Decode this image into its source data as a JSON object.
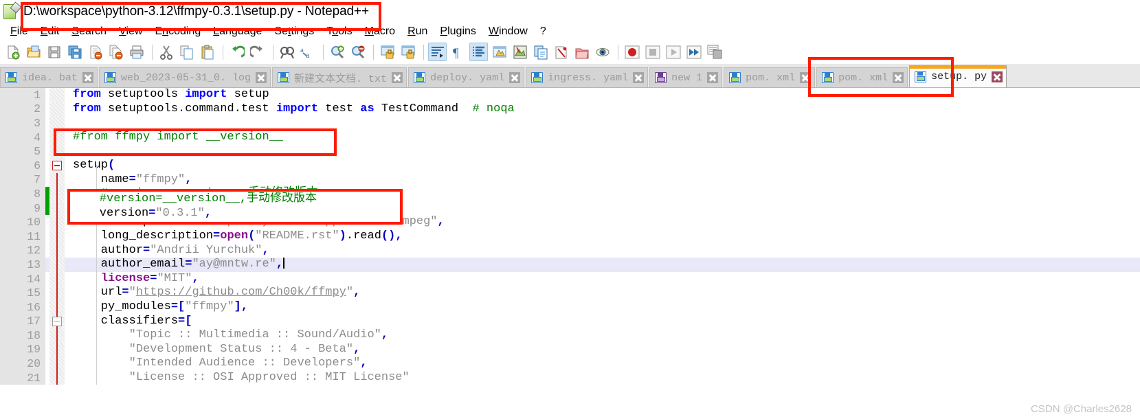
{
  "window": {
    "title": "D:\\workspace\\python-3.12\\ffmpy-0.3.1\\setup.py - Notepad++",
    "app_icon": "notepad-plus-plus-icon"
  },
  "menubar": {
    "items": [
      {
        "label": "File",
        "accel": "F"
      },
      {
        "label": "Edit",
        "accel": "E"
      },
      {
        "label": "Search",
        "accel": "S"
      },
      {
        "label": "View",
        "accel": "V"
      },
      {
        "label": "Encoding",
        "accel": "n"
      },
      {
        "label": "Language",
        "accel": "L"
      },
      {
        "label": "Settings",
        "accel": "t"
      },
      {
        "label": "Tools",
        "accel": "o"
      },
      {
        "label": "Macro",
        "accel": "M"
      },
      {
        "label": "Run",
        "accel": "R"
      },
      {
        "label": "Plugins",
        "accel": "P"
      },
      {
        "label": "Window",
        "accel": "W"
      },
      {
        "label": "?",
        "accel": ""
      }
    ]
  },
  "toolbar": {
    "buttons": [
      {
        "name": "new-file-icon",
        "pressed": false
      },
      {
        "name": "open-file-icon",
        "pressed": false
      },
      {
        "name": "save-icon",
        "pressed": false
      },
      {
        "name": "save-all-icon",
        "pressed": false
      },
      {
        "name": "close-file-icon",
        "pressed": false
      },
      {
        "name": "close-all-files-icon",
        "pressed": false
      },
      {
        "name": "print-icon",
        "pressed": false
      },
      {
        "name": "cut-icon",
        "pressed": false
      },
      {
        "name": "copy-icon",
        "pressed": false
      },
      {
        "name": "paste-icon",
        "pressed": false
      },
      {
        "name": "undo-icon",
        "pressed": false
      },
      {
        "name": "redo-icon",
        "pressed": false
      },
      {
        "name": "find-icon",
        "pressed": false
      },
      {
        "name": "replace-icon",
        "pressed": false
      },
      {
        "name": "zoom-in-icon",
        "pressed": false
      },
      {
        "name": "zoom-out-icon",
        "pressed": false
      },
      {
        "name": "sync-vertical-scroll-icon",
        "pressed": false
      },
      {
        "name": "sync-horizontal-scroll-icon",
        "pressed": false
      },
      {
        "name": "word-wrap-icon",
        "pressed": true
      },
      {
        "name": "show-all-characters-icon",
        "pressed": false
      },
      {
        "name": "show-indent-guide-icon",
        "pressed": true
      },
      {
        "name": "user-defined-dialog-icon",
        "pressed": false
      },
      {
        "name": "document-map-icon",
        "pressed": false
      },
      {
        "name": "function-list-icon",
        "pressed": false
      },
      {
        "name": "folder-as-workspace-icon",
        "pressed": false
      },
      {
        "name": "monitoring-icon",
        "pressed": false
      },
      {
        "name": "record-macro-icon",
        "pressed": false
      },
      {
        "name": "stop-recording-icon",
        "pressed": false
      },
      {
        "name": "play-macro-icon",
        "pressed": false
      },
      {
        "name": "run-macro-multiple-icon",
        "pressed": false
      },
      {
        "name": "save-macro-icon",
        "pressed": false
      }
    ]
  },
  "tabs": [
    {
      "label": "idea. bat",
      "icon": "saved-file-icon",
      "active": false
    },
    {
      "label": "web_2023-05-31_0. log",
      "icon": "saved-file-icon",
      "active": false
    },
    {
      "label": "新建文本文档. txt",
      "icon": "saved-file-icon",
      "active": false
    },
    {
      "label": "deploy. yaml",
      "icon": "saved-file-icon",
      "active": false
    },
    {
      "label": "ingress. yaml",
      "icon": "saved-file-icon",
      "active": false
    },
    {
      "label": "new 1",
      "icon": "unsaved-file-icon",
      "active": false
    },
    {
      "label": "pom. xml",
      "icon": "saved-file-icon",
      "active": false
    },
    {
      "label": "pom. xml",
      "icon": "saved-file-icon",
      "active": false
    },
    {
      "label": "setup. py",
      "icon": "saved-file-icon",
      "active": true
    }
  ],
  "editor": {
    "filename": "setup.py",
    "language": "Python",
    "current_line": 13,
    "lines": [
      {
        "n": "1",
        "changed": false,
        "fold": "",
        "foldline": false
      },
      {
        "n": "2",
        "changed": false,
        "fold": "",
        "foldline": false
      },
      {
        "n": "3",
        "changed": false,
        "fold": "",
        "foldline": false
      },
      {
        "n": "4",
        "changed": false,
        "fold": "",
        "foldline": false
      },
      {
        "n": "5",
        "changed": false,
        "fold": "",
        "foldline": false
      },
      {
        "n": "6",
        "changed": false,
        "fold": "open",
        "foldline": false
      },
      {
        "n": "7",
        "changed": false,
        "fold": "",
        "foldline": true
      },
      {
        "n": "8",
        "changed": true,
        "fold": "",
        "foldline": true
      },
      {
        "n": "9",
        "changed": true,
        "fold": "",
        "foldline": true
      },
      {
        "n": "10",
        "changed": false,
        "fold": "",
        "foldline": true
      },
      {
        "n": "11",
        "changed": false,
        "fold": "",
        "foldline": true
      },
      {
        "n": "12",
        "changed": false,
        "fold": "",
        "foldline": true
      },
      {
        "n": "13",
        "changed": false,
        "fold": "",
        "foldline": true
      },
      {
        "n": "14",
        "changed": false,
        "fold": "",
        "foldline": true
      },
      {
        "n": "15",
        "changed": false,
        "fold": "",
        "foldline": true
      },
      {
        "n": "16",
        "changed": false,
        "fold": "",
        "foldline": true
      },
      {
        "n": "17",
        "changed": false,
        "fold": "gray",
        "foldline": true
      },
      {
        "n": "18",
        "changed": false,
        "fold": "",
        "foldline": true
      },
      {
        "n": "19",
        "changed": false,
        "fold": "",
        "foldline": true
      },
      {
        "n": "20",
        "changed": false,
        "fold": "",
        "foldline": true
      },
      {
        "n": "21",
        "changed": false,
        "fold": "",
        "foldline": true
      }
    ],
    "code": [
      "from setuptools import setup",
      "from setuptools.command.test import test as TestCommand  # noqa",
      "",
      "#from ffmpy import __version__",
      "",
      "setup(",
      "    name=\"ffmpy\",",
      "    #version=__version__,手动修改版本",
      "    version=\"0.3.1\",",
      "    description=\"A simple Python wrapper for ffmpeg\",",
      "    long_description=open(\"README.rst\").read(),",
      "    author=\"Andrii Yurchuk\",",
      "    author_email=\"ay@mntw.re\",",
      "    license=\"MIT\",",
      "    url=\"https://github.com/Ch00k/ffmpy\",",
      "    py_modules=[\"ffmpy\"],",
      "    classifiers=[",
      "        \"Topic :: Multimedia :: Sound/Audio\",",
      "        \"Development Status :: 4 - Beta\",",
      "        \"Intended Audience :: Developers\",",
      "        \"License :: OSI Approved :: MIT License\""
    ]
  },
  "annotations": [
    {
      "name": "title-highlight-box",
      "note": "red box around window title"
    },
    {
      "name": "comment-line-highlight-box",
      "note": "red box around line 4 commented import"
    },
    {
      "name": "version-highlight-box",
      "note": "red box around lines 8-9 version setting"
    },
    {
      "name": "active-tab-highlight-box",
      "note": "red box around setup.py tab"
    }
  ],
  "watermark": {
    "text": "CSDN @Charles2628"
  },
  "colors": {
    "annotation_red": "#ff1a00",
    "active_tab_accent": "#f5a623",
    "keyword_blue": "#0000ff",
    "comment_green": "#008000",
    "string_gray": "#8c8c8c",
    "builtin_purple": "#8a0f8a",
    "change_marker_green": "#00a000",
    "current_line_bg": "#e8e8f8"
  }
}
